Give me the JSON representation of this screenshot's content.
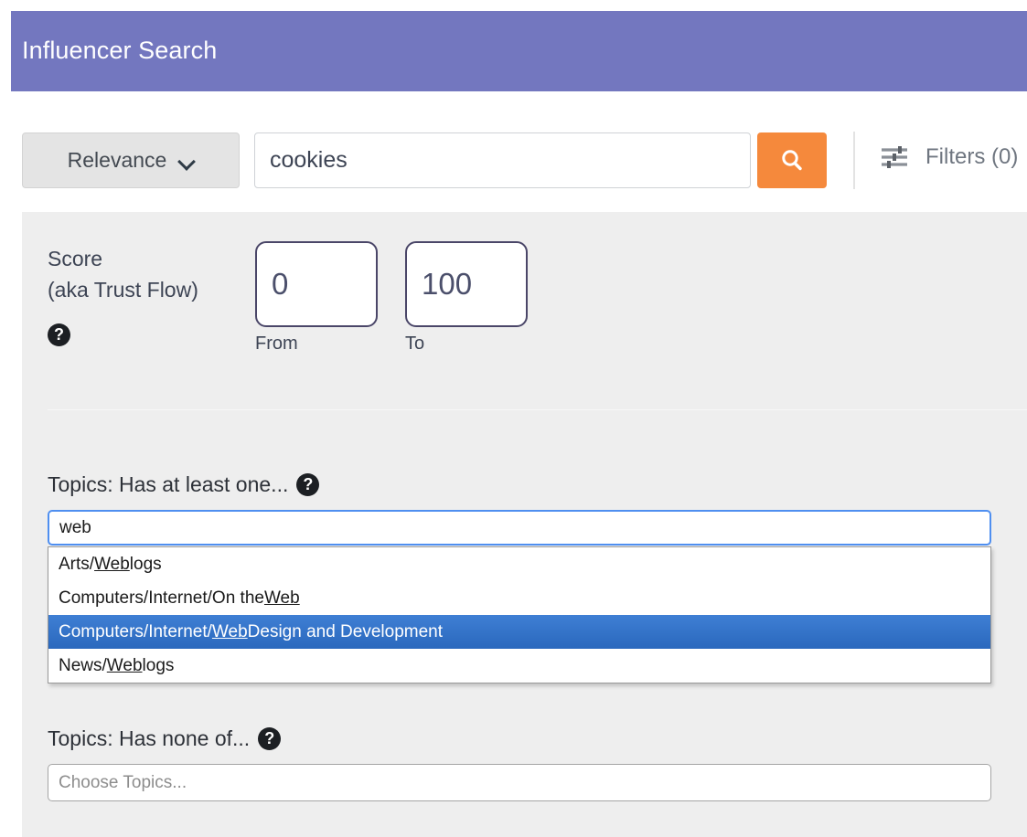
{
  "header": {
    "title": "Influencer Search",
    "background": "#7377bf"
  },
  "toolbar": {
    "sort_selected": "Relevance",
    "sort_chevron_icon": "chevron-down-icon",
    "search_value": "cookies",
    "search_placeholder": "",
    "search_button_icon": "search-icon",
    "search_button_color": "#f5893c",
    "filters_icon": "sliders-icon",
    "filters_label": "Filters (0)"
  },
  "score": {
    "label_line1": "Score",
    "label_line2": "(aka Trust Flow)",
    "help_icon": "help-circle-icon",
    "from_value": "0",
    "to_value": "100",
    "from_caption": "From",
    "to_caption": "To",
    "border_color": "#4a4668"
  },
  "topics_any": {
    "label": "Topics: Has at least one...",
    "help_icon": "help-circle-icon",
    "input_value": "web",
    "input_focus_color": "#4f8ff0",
    "suggestions": [
      {
        "before": "Arts/",
        "match": "Web",
        "after": "logs",
        "selected": false
      },
      {
        "before": "Computers/Internet/On the ",
        "match": "Web",
        "after": "",
        "selected": false
      },
      {
        "before": "Computers/Internet/",
        "match": "Web",
        "after": " Design and Development",
        "selected": true
      },
      {
        "before": "News/",
        "match": "Web",
        "after": "logs",
        "selected": false
      }
    ],
    "highlight_color": "#2a68bd"
  },
  "topics_none": {
    "label": "Topics: Has none of...",
    "help_icon": "help-circle-icon",
    "placeholder": "Choose Topics..."
  }
}
